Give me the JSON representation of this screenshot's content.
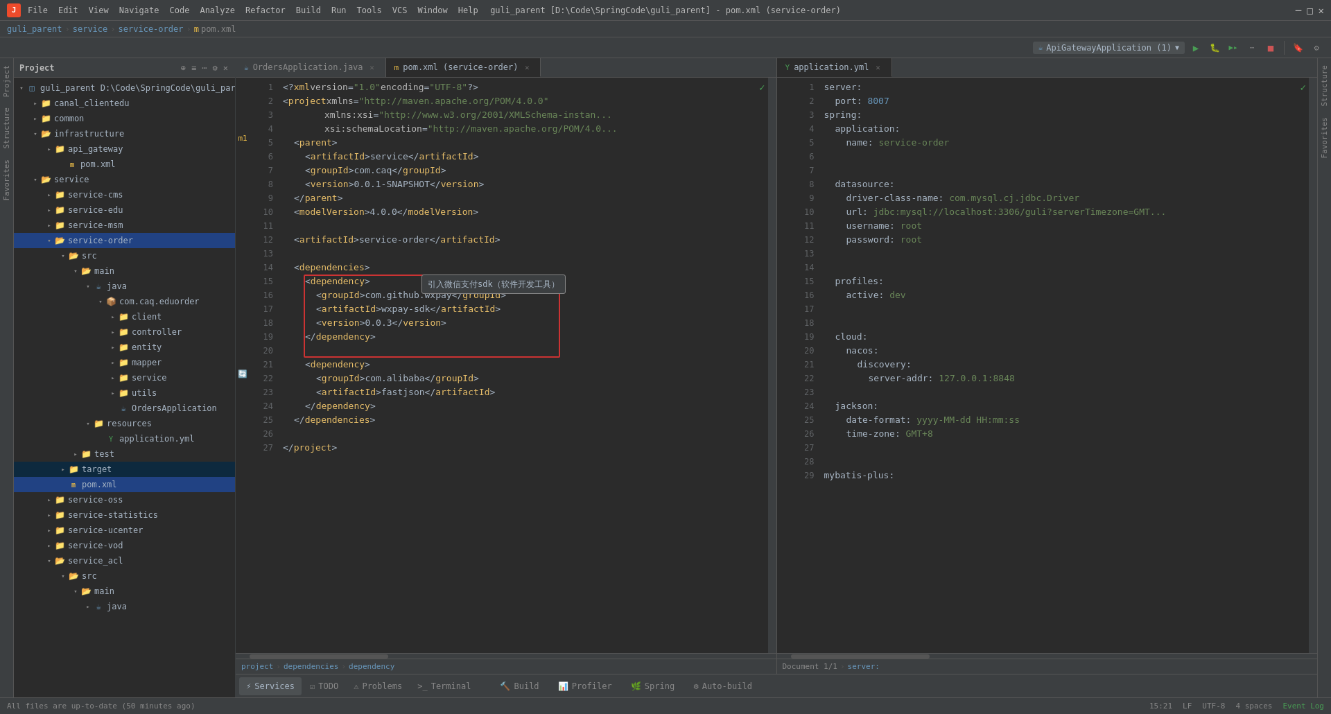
{
  "titlebar": {
    "menus": [
      "File",
      "Edit",
      "View",
      "Navigate",
      "Code",
      "Analyze",
      "Refactor",
      "Build",
      "Run",
      "Tools",
      "VCS",
      "Window",
      "Help"
    ],
    "title": "guli_parent [D:\\Code\\SpringCode\\guli_parent] - pom.xml (service-order)",
    "controls": [
      "─",
      "□",
      "✕"
    ]
  },
  "breadcrumb": {
    "parts": [
      "guli_parent",
      "service",
      "service-order",
      "pom.xml"
    ]
  },
  "project_panel": {
    "title": "Project",
    "tree": [
      {
        "id": "guli_parent",
        "label": "guli_parent D:\\Code\\SpringCode\\guli_pare...",
        "level": 0,
        "type": "module",
        "expanded": true
      },
      {
        "id": "canal_clientedu",
        "label": "canal_clientedu",
        "level": 1,
        "type": "folder",
        "expanded": false
      },
      {
        "id": "common",
        "label": "common",
        "level": 1,
        "type": "folder",
        "expanded": false
      },
      {
        "id": "infrastructure",
        "label": "infrastructure",
        "level": 1,
        "type": "folder",
        "expanded": true
      },
      {
        "id": "api_gateway",
        "label": "api_gateway",
        "level": 2,
        "type": "folder",
        "expanded": false
      },
      {
        "id": "pom_infra",
        "label": "pom.xml",
        "level": 3,
        "type": "xml"
      },
      {
        "id": "service",
        "label": "service",
        "level": 1,
        "type": "folder",
        "expanded": true
      },
      {
        "id": "service-cms",
        "label": "service-cms",
        "level": 2,
        "type": "folder",
        "expanded": false
      },
      {
        "id": "service-edu",
        "label": "service-edu",
        "level": 2,
        "type": "folder",
        "expanded": false
      },
      {
        "id": "service-msm",
        "label": "service-msm",
        "level": 2,
        "type": "folder",
        "expanded": false
      },
      {
        "id": "service-order",
        "label": "service-order",
        "level": 2,
        "type": "folder",
        "expanded": true,
        "selected": true
      },
      {
        "id": "src",
        "label": "src",
        "level": 3,
        "type": "folder",
        "expanded": true
      },
      {
        "id": "main",
        "label": "main",
        "level": 4,
        "type": "folder",
        "expanded": true
      },
      {
        "id": "java",
        "label": "java",
        "level": 5,
        "type": "folder",
        "expanded": true
      },
      {
        "id": "com_caq_eduorder",
        "label": "com.caq.eduorder",
        "level": 6,
        "type": "folder",
        "expanded": true
      },
      {
        "id": "client",
        "label": "client",
        "level": 7,
        "type": "folder",
        "expanded": false
      },
      {
        "id": "controller",
        "label": "controller",
        "level": 7,
        "type": "folder",
        "expanded": false
      },
      {
        "id": "entity",
        "label": "entity",
        "level": 7,
        "type": "folder",
        "expanded": false
      },
      {
        "id": "mapper",
        "label": "mapper",
        "level": 7,
        "type": "folder",
        "expanded": false
      },
      {
        "id": "service_pkg",
        "label": "service",
        "level": 7,
        "type": "folder",
        "expanded": false
      },
      {
        "id": "utils",
        "label": "utils",
        "level": 7,
        "type": "folder",
        "expanded": false
      },
      {
        "id": "OrdersApplication",
        "label": "OrdersApplication",
        "level": 7,
        "type": "java"
      },
      {
        "id": "resources",
        "label": "resources",
        "level": 5,
        "type": "folder",
        "expanded": true
      },
      {
        "id": "application_yml",
        "label": "application.yml",
        "level": 6,
        "type": "yaml"
      },
      {
        "id": "test",
        "label": "test",
        "level": 4,
        "type": "folder",
        "expanded": false
      },
      {
        "id": "target",
        "label": "target",
        "level": 3,
        "type": "folder",
        "expanded": false,
        "highlighted": true
      },
      {
        "id": "pom_order",
        "label": "pom.xml",
        "level": 3,
        "type": "xml",
        "selected": true
      },
      {
        "id": "service-oss",
        "label": "service-oss",
        "level": 2,
        "type": "folder",
        "expanded": false
      },
      {
        "id": "service-statistics",
        "label": "service-statistics",
        "level": 2,
        "type": "folder",
        "expanded": false
      },
      {
        "id": "service-ucenter",
        "label": "service-ucenter",
        "level": 2,
        "type": "folder",
        "expanded": false
      },
      {
        "id": "service-vod",
        "label": "service-vod",
        "level": 2,
        "type": "folder",
        "expanded": false
      },
      {
        "id": "service_acl",
        "label": "service_acl",
        "level": 2,
        "type": "folder",
        "expanded": true
      },
      {
        "id": "src_acl",
        "label": "src",
        "level": 3,
        "type": "folder",
        "expanded": true
      },
      {
        "id": "main_acl",
        "label": "main",
        "level": 4,
        "type": "folder",
        "expanded": true
      },
      {
        "id": "java_acl",
        "label": "java",
        "level": 5,
        "type": "folder",
        "expanded": false
      }
    ]
  },
  "tabs_left": [
    {
      "id": "orders-app",
      "label": "OrdersApplication.java",
      "active": false,
      "modified": false
    },
    {
      "id": "pom-order",
      "label": "pom.xml (service-order)",
      "active": true,
      "modified": false
    }
  ],
  "tabs_right": [
    {
      "id": "application-yml",
      "label": "application.yml",
      "active": true,
      "modified": false
    }
  ],
  "pom_xml": {
    "lines": [
      {
        "n": 1,
        "content": "<?xml version=\"1.0\" encoding=\"UTF-8\"?>"
      },
      {
        "n": 2,
        "content": "<project xmlns=\"http://maven.apache.org/POM/4.0.0\""
      },
      {
        "n": 3,
        "content": "         xmlns:xsi=\"http://www.w3.org/2001/XMLSchema-instan..."
      },
      {
        "n": 4,
        "content": "         xsi:schemaLocation=\"http://maven.apache.org/POM/4.0..."
      },
      {
        "n": 5,
        "content": "    <parent>"
      },
      {
        "n": 6,
        "content": "        <artifactId>service</artifactId>"
      },
      {
        "n": 7,
        "content": "        <groupId>com.caq</groupId>"
      },
      {
        "n": 8,
        "content": "        <version>0.0.1-SNAPSHOT</version>"
      },
      {
        "n": 9,
        "content": "    </parent>"
      },
      {
        "n": 10,
        "content": "    <modelVersion>4.0.0</modelVersion>"
      },
      {
        "n": 11,
        "content": ""
      },
      {
        "n": 12,
        "content": "    <artifactId>service-order</artifactId>"
      },
      {
        "n": 13,
        "content": ""
      },
      {
        "n": 14,
        "content": "    <dependencies>"
      },
      {
        "n": 15,
        "content": "        <dependency>"
      },
      {
        "n": 16,
        "content": "            <groupId>com.github.wxpay</groupId>"
      },
      {
        "n": 17,
        "content": "            <artifactId>wxpay-sdk</artifactId>"
      },
      {
        "n": 18,
        "content": "            <version>0.0.3</version>"
      },
      {
        "n": 19,
        "content": "        </dependency>"
      },
      {
        "n": 20,
        "content": ""
      },
      {
        "n": 21,
        "content": "        <dependency>"
      },
      {
        "n": 22,
        "content": "            <groupId>com.alibaba</groupId>"
      },
      {
        "n": 23,
        "content": "            <artifactId>fastjson</artifactId>"
      },
      {
        "n": 24,
        "content": "        </dependency>"
      },
      {
        "n": 25,
        "content": "    </dependencies>"
      },
      {
        "n": 26,
        "content": ""
      },
      {
        "n": 27,
        "content": "</project>"
      }
    ],
    "tooltip": "引入微信支付sdk（软件开发工具）",
    "breadcrumb": "project > dependencies > dependency"
  },
  "application_yml": {
    "lines": [
      {
        "n": 1,
        "content": "server:"
      },
      {
        "n": 2,
        "content": "  port: 8007"
      },
      {
        "n": 3,
        "content": "spring:"
      },
      {
        "n": 4,
        "content": "  application:"
      },
      {
        "n": 5,
        "content": "    name: service-order"
      },
      {
        "n": 6,
        "content": ""
      },
      {
        "n": 7,
        "content": ""
      },
      {
        "n": 8,
        "content": "  datasource:"
      },
      {
        "n": 9,
        "content": "    driver-class-name: com.mysql.cj.jdbc.Driver"
      },
      {
        "n": 10,
        "content": "    url: jdbc:mysql://localhost:3306/guli?serverTimezone=GMT..."
      },
      {
        "n": 11,
        "content": "    username: root"
      },
      {
        "n": 12,
        "content": "    password: root"
      },
      {
        "n": 13,
        "content": ""
      },
      {
        "n": 14,
        "content": ""
      },
      {
        "n": 15,
        "content": "  profiles:"
      },
      {
        "n": 16,
        "content": "    active: dev"
      },
      {
        "n": 17,
        "content": ""
      },
      {
        "n": 18,
        "content": ""
      },
      {
        "n": 19,
        "content": "  cloud:"
      },
      {
        "n": 20,
        "content": "    nacos:"
      },
      {
        "n": 21,
        "content": "      discovery:"
      },
      {
        "n": 22,
        "content": "        server-addr: 127.0.0.1:8848"
      },
      {
        "n": 23,
        "content": ""
      },
      {
        "n": 24,
        "content": "  jackson:"
      },
      {
        "n": 25,
        "content": "    date-format: yyyy-MM-dd HH:mm:ss"
      },
      {
        "n": 26,
        "content": "    time-zone: GMT+8"
      },
      {
        "n": 27,
        "content": ""
      },
      {
        "n": 28,
        "content": ""
      },
      {
        "n": 29,
        "content": "mybatis-plus:"
      }
    ],
    "breadcrumb": "Document 1/1 > server:"
  },
  "run_config": {
    "label": "ApiGatewayApplication (1)"
  },
  "bottom_tabs": [
    {
      "id": "services",
      "label": "Services",
      "active": true
    },
    {
      "id": "todo",
      "label": "TODO"
    },
    {
      "id": "problems",
      "label": "Problems"
    },
    {
      "id": "terminal",
      "label": "Terminal"
    }
  ],
  "build_tabs": [
    {
      "id": "build",
      "label": "Build"
    },
    {
      "id": "profiler",
      "label": "Profiler"
    },
    {
      "id": "spring",
      "label": "Spring"
    },
    {
      "id": "auto-build",
      "label": "Auto-build"
    }
  ],
  "status_bar": {
    "left": "All files are up-to-date (50 minutes ago)",
    "right_items": [
      "15:21",
      "LF",
      "UTF-8",
      "4 spaces",
      "Event Log"
    ]
  },
  "right_panels": [
    "Structure",
    "Favorites"
  ]
}
